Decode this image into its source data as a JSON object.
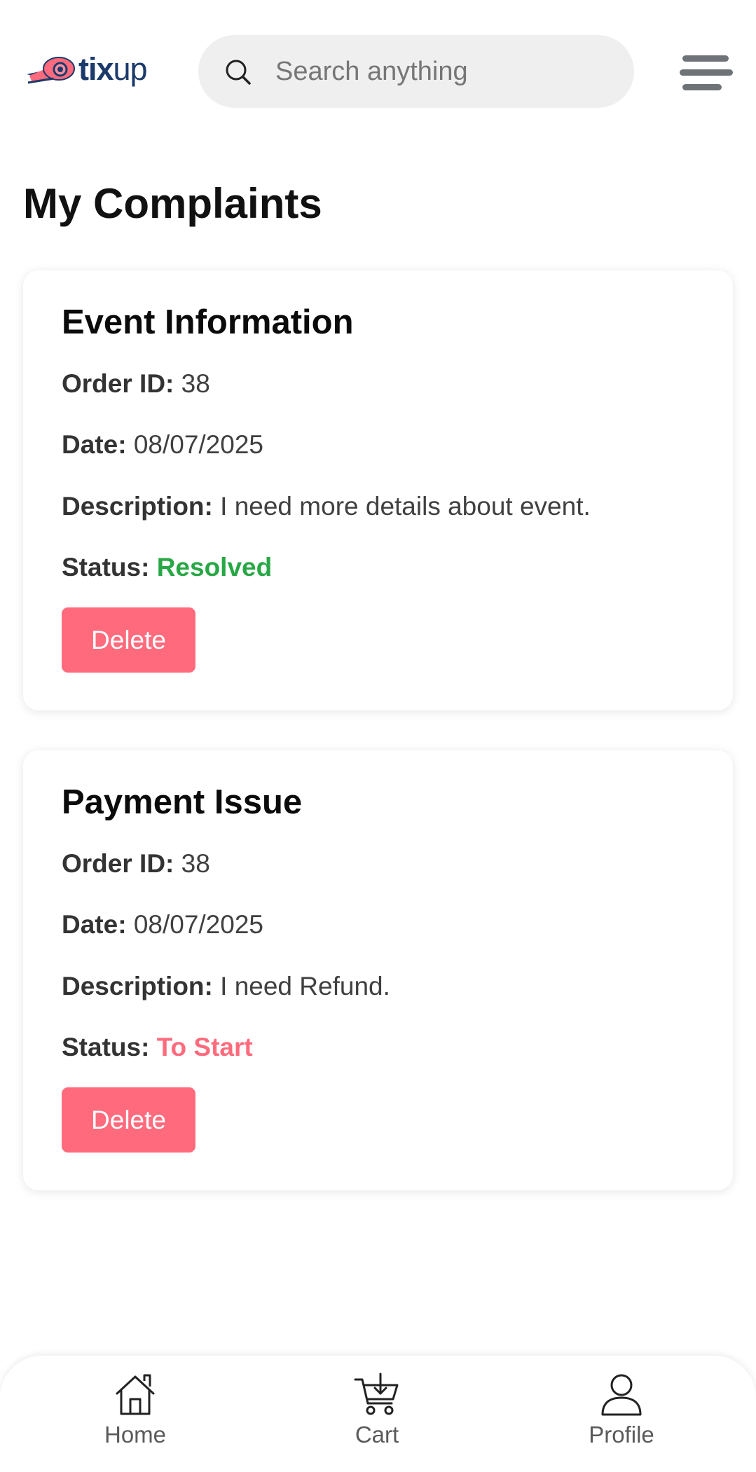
{
  "header": {
    "logo_text_bold": "tix",
    "logo_text_light": "up",
    "search_placeholder": "Search anything"
  },
  "page_title": "My Complaints",
  "complaints": [
    {
      "title": "Event Information",
      "order_label": "Order ID:",
      "order_id": "38",
      "date_label": "Date:",
      "date": "08/07/2025",
      "description_label": "Description:",
      "description": "I need more details about event.",
      "status_label": "Status:",
      "status": "Resolved",
      "status_color": "#28a745",
      "delete_label": "Delete"
    },
    {
      "title": "Payment Issue",
      "order_label": "Order ID:",
      "order_id": "38",
      "date_label": "Date:",
      "date": "08/07/2025",
      "description_label": "Description:",
      "description": "I need Refund.",
      "status_label": "Status:",
      "status": "To Start",
      "status_color": "#ff6b7d",
      "delete_label": "Delete"
    }
  ],
  "bottom_nav": [
    {
      "label": "Home",
      "icon": "home-icon"
    },
    {
      "label": "Cart",
      "icon": "cart-icon"
    },
    {
      "label": "Profile",
      "icon": "profile-icon"
    }
  ],
  "colors": {
    "accent": "#ff6b7d",
    "brand_navy": "#1c3a6b",
    "resolved": "#28a745"
  }
}
